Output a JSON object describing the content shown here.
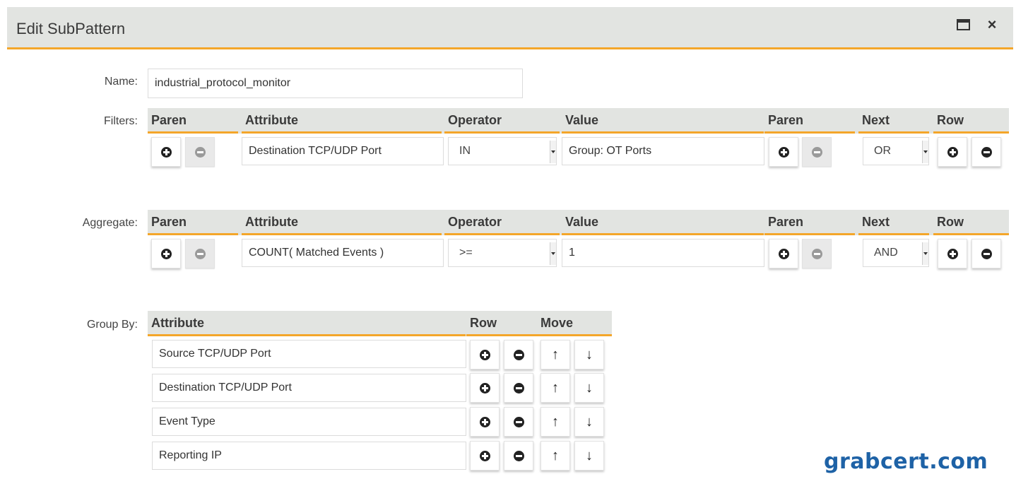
{
  "dialog": {
    "title": "Edit SubPattern",
    "controls": {
      "maximize_icon": "maximize-icon",
      "close_icon": "close-icon",
      "close_glyph": "×"
    }
  },
  "name": {
    "label": "Name:",
    "value": "industrial_protocol_monitor"
  },
  "grid_headers": {
    "paren_open": "Paren",
    "attribute": "Attribute",
    "operator": "Operator",
    "value": "Value",
    "paren_close": "Paren",
    "next": "Next",
    "row": "Row"
  },
  "filters": {
    "label": "Filters:",
    "row": {
      "attribute": "Destination TCP/UDP Port",
      "operator": "IN",
      "value": "Group: OT Ports",
      "next": "OR"
    }
  },
  "aggregate": {
    "label": "Aggregate:",
    "row": {
      "attribute": "COUNT( Matched Events )",
      "operator": ">=",
      "value": "1",
      "next": "AND"
    }
  },
  "group_by": {
    "label": "Group By:",
    "headers": {
      "attribute": "Attribute",
      "row": "Row",
      "move": "Move"
    },
    "items": [
      {
        "attribute": "Source TCP/UDP Port"
      },
      {
        "attribute": "Destination TCP/UDP Port"
      },
      {
        "attribute": "Event Type"
      },
      {
        "attribute": "Reporting IP"
      }
    ],
    "up_glyph": "↑",
    "down_glyph": "↓"
  },
  "colors": {
    "accent": "#f4a62a",
    "header_bg": "#e2e4e1",
    "watermark": "#1e62a6"
  },
  "watermark": "grabcert.com"
}
